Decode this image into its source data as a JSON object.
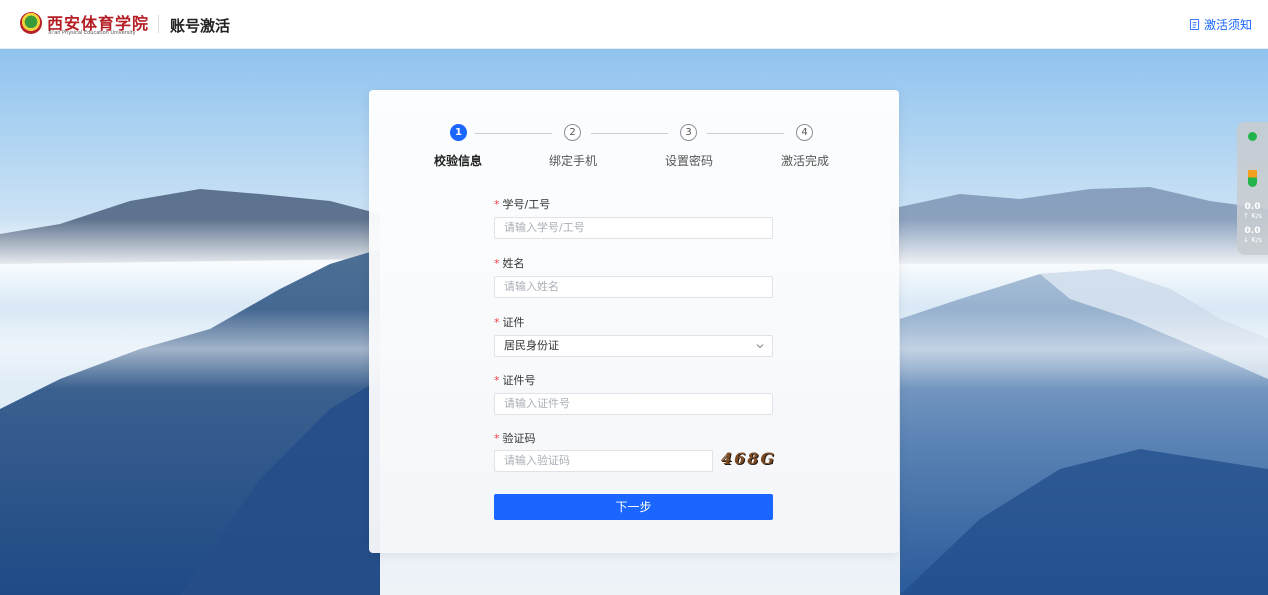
{
  "header": {
    "school_name_cn": "西安体育学院",
    "school_name_en": "Xi'an Physical Education University",
    "app_title": "账号激活",
    "notice_link": "激活须知"
  },
  "steps": [
    {
      "number": "1",
      "label": "校验信息",
      "active": true
    },
    {
      "number": "2",
      "label": "绑定手机",
      "active": false
    },
    {
      "number": "3",
      "label": "设置密码",
      "active": false
    },
    {
      "number": "4",
      "label": "激活完成",
      "active": false
    }
  ],
  "form": {
    "required_mark": "*",
    "student_id": {
      "label": "学号/工号",
      "placeholder": "请输入学号/工号"
    },
    "name": {
      "label": "姓名",
      "placeholder": "请输入姓名"
    },
    "id_type": {
      "label": "证件",
      "selected": "居民身份证"
    },
    "id_number": {
      "label": "证件号",
      "placeholder": "请输入证件号"
    },
    "captcha": {
      "label": "验证码",
      "placeholder": "请输入验证码",
      "image_text": "468G"
    },
    "next_button": "下一步"
  },
  "speed_widget": {
    "upload_value": "0.0",
    "upload_unit": "↑ K/s",
    "download_value": "0.0",
    "download_unit": "↓ K/s"
  },
  "colors": {
    "accent": "#1a66ff",
    "required": "#f04040",
    "brand": "#b41d24"
  },
  "icons": [
    "document-icon",
    "chevron-down-icon",
    "school-emblem-icon"
  ]
}
